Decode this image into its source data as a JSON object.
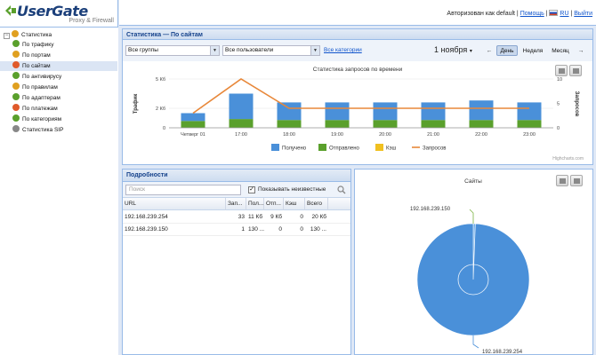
{
  "brand": {
    "logo_name": "UserGate",
    "logo_sub": "Proxy & Firewall"
  },
  "header": {
    "auth_text": "Авторизован как default |",
    "help": "Помощь",
    "lang": "RU",
    "logout": "Выйти"
  },
  "tree": {
    "root": "Статистика",
    "items": [
      {
        "label": "По трафику",
        "icon_color": "#5aa02c"
      },
      {
        "label": "По портам",
        "icon_color": "#e0a020"
      },
      {
        "label": "По сайтам",
        "icon_color": "#e05a2a",
        "selected": true
      },
      {
        "label": "По антивирусу",
        "icon_color": "#5aa02c"
      },
      {
        "label": "По правилам",
        "icon_color": "#e0a020"
      },
      {
        "label": "По адаптерам",
        "icon_color": "#5aa02c"
      },
      {
        "label": "По платежам",
        "icon_color": "#e05a2a"
      },
      {
        "label": "По категориям",
        "icon_color": "#5aa02c"
      }
    ],
    "sip": "Статистика SIP"
  },
  "main": {
    "title": "Статистика — По сайтам",
    "groups": "Все группы",
    "users": "Все пользователи",
    "categories_link": "Все категории",
    "date": "1 ноября",
    "date_arrow": "▾",
    "prev": "←",
    "day": "День",
    "week": "Неделя",
    "month": "Месяц",
    "next": "→"
  },
  "chart_data": {
    "type": "bar",
    "title": "Статистика запросов по времени",
    "ylabel": "Трафик",
    "ylabel_right": "Запросов",
    "yticks_left": [
      "5 Кб",
      "2 Кб",
      "0"
    ],
    "yticks_right": [
      "10",
      "5",
      "0"
    ],
    "categories": [
      "Четверг 01",
      "17:00",
      "18:00",
      "19:00",
      "20:00",
      "21:00",
      "22:00",
      "23:00"
    ],
    "ylim": [
      0,
      5
    ],
    "ylim_right": [
      0,
      10
    ],
    "series": [
      {
        "name": "Получено",
        "color": "#4a90d9",
        "values": [
          0.8,
          2.6,
          1.8,
          1.8,
          1.8,
          1.8,
          2.0,
          1.8
        ]
      },
      {
        "name": "Отправлено",
        "color": "#5aa02c",
        "values": [
          0.7,
          0.9,
          0.8,
          0.8,
          0.8,
          0.8,
          0.8,
          0.8
        ]
      },
      {
        "name": "Кэш",
        "color": "#f0c020",
        "values": [
          0,
          0,
          0,
          0,
          0,
          0,
          0,
          0
        ]
      },
      {
        "name": "Запросов",
        "type": "line",
        "color": "#e8883a",
        "values": [
          3,
          10,
          4,
          4,
          4,
          4,
          4,
          4
        ]
      }
    ],
    "credit": "Highcharts.com"
  },
  "details": {
    "title": "Подробности",
    "search_placeholder": "Поиск",
    "show_unknown": "Показывать неизвестные",
    "columns": [
      "URL",
      "Зап...",
      "Пол...",
      "Отп...",
      "Кэш",
      "Всего"
    ],
    "rows": [
      [
        "192.168.239.254",
        "33",
        "11 Кб",
        "9 Кб",
        "0",
        "20 Кб"
      ],
      [
        "192.168.239.150",
        "1",
        "130 ...",
        "0",
        "0",
        "130 ..."
      ]
    ]
  },
  "sites": {
    "title": "Сайты",
    "pie": {
      "type": "pie",
      "slices": [
        {
          "label": "192.168.239.150",
          "value": 0.6
        },
        {
          "label": "192.168.239.254",
          "value": 99.4
        }
      ],
      "color": "#4a90d9"
    }
  },
  "icons": [
    "print-icon",
    "export-icon",
    "search-icon",
    "tree-folder-icon"
  ]
}
